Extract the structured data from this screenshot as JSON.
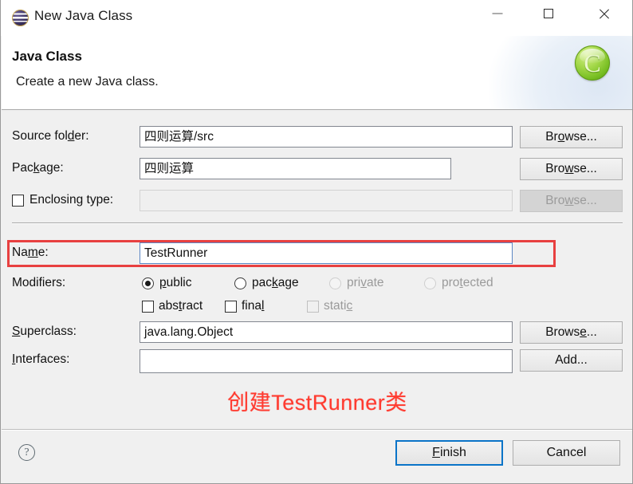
{
  "window": {
    "title": "New Java Class",
    "icon": "eclipse-globe-icon",
    "minimize_label": "Minimize",
    "maximize_label": "Maximize",
    "close_label": "Close"
  },
  "banner": {
    "title": "Java Class",
    "subtitle": "Create a new Java class.",
    "icon": "new-class-wizard-icon",
    "icon_glyph": "C"
  },
  "form": {
    "source_folder": {
      "label": "Source folder:",
      "mnemonic_before": "Source fol",
      "mnemonic": "d",
      "mnemonic_after": "er:",
      "value": "四则运算/src",
      "browse_label": "Browse...",
      "browse_mnemonic_before": "Br",
      "browse_mnemonic": "o",
      "browse_mnemonic_after": "wse..."
    },
    "package": {
      "label": "Package:",
      "mnemonic_before": "Pac",
      "mnemonic": "k",
      "mnemonic_after": "age:",
      "value": "四则运算",
      "browse_label": "Browse...",
      "browse_mnemonic_before": "Bro",
      "browse_mnemonic": "w",
      "browse_mnemonic_after": "se..."
    },
    "enclosing_type": {
      "label": "Enclosing type:",
      "checked": false,
      "value": "",
      "browse_label": "Browse...",
      "browse_mnemonic_before": "Bro",
      "browse_mnemonic": "w",
      "browse_mnemonic_after": "se...",
      "enabled": false
    },
    "name": {
      "label": "Name:",
      "mnemonic_before": "Na",
      "mnemonic": "m",
      "mnemonic_after": "e:",
      "value": "TestRunner",
      "focused": true
    },
    "modifiers": {
      "label": "Modifiers:",
      "access": [
        {
          "label": "public",
          "mnemonic_before": "",
          "mnemonic": "p",
          "mnemonic_after": "ublic",
          "checked": true,
          "enabled": true
        },
        {
          "label": "package",
          "mnemonic_before": "pac",
          "mnemonic": "k",
          "mnemonic_after": "age",
          "checked": false,
          "enabled": true
        },
        {
          "label": "private",
          "mnemonic_before": "pri",
          "mnemonic": "v",
          "mnemonic_after": "ate",
          "checked": false,
          "enabled": false
        },
        {
          "label": "protected",
          "mnemonic_before": "pro",
          "mnemonic": "t",
          "mnemonic_after": "ected",
          "checked": false,
          "enabled": false
        }
      ],
      "flags": [
        {
          "label": "abstract",
          "mnemonic_before": "abs",
          "mnemonic": "t",
          "mnemonic_after": "ract",
          "checked": false,
          "enabled": true
        },
        {
          "label": "final",
          "mnemonic_before": "fina",
          "mnemonic": "l",
          "mnemonic_after": "",
          "checked": false,
          "enabled": true
        },
        {
          "label": "static",
          "mnemonic_before": "stati",
          "mnemonic": "c",
          "mnemonic_after": "",
          "checked": false,
          "enabled": false
        }
      ]
    },
    "superclass": {
      "label": "Superclass:",
      "mnemonic_before": "",
      "mnemonic": "S",
      "mnemonic_after": "uperclass:",
      "value": "java.lang.Object",
      "browse_label": "Browse...",
      "browse_mnemonic_before": "Brows",
      "browse_mnemonic": "e",
      "browse_mnemonic_after": "..."
    },
    "interfaces": {
      "label": "Interfaces:",
      "mnemonic_before": "",
      "mnemonic": "I",
      "mnemonic_after": "nterfaces:",
      "value": "",
      "add_label": "Add...",
      "add_mnemonic_before": "Add",
      "add_mnemonic": "",
      "add_mnemonic_after": "..."
    }
  },
  "annotation": {
    "text": "创建TestRunner类",
    "color": "#ff3b30",
    "box_color": "#e84040",
    "target": "name-field"
  },
  "footer": {
    "help_label": "?",
    "finish": {
      "label": "Finish",
      "mnemonic_before": "",
      "mnemonic": "F",
      "mnemonic_after": "inish",
      "default": true
    },
    "cancel": {
      "label": "Cancel"
    }
  }
}
